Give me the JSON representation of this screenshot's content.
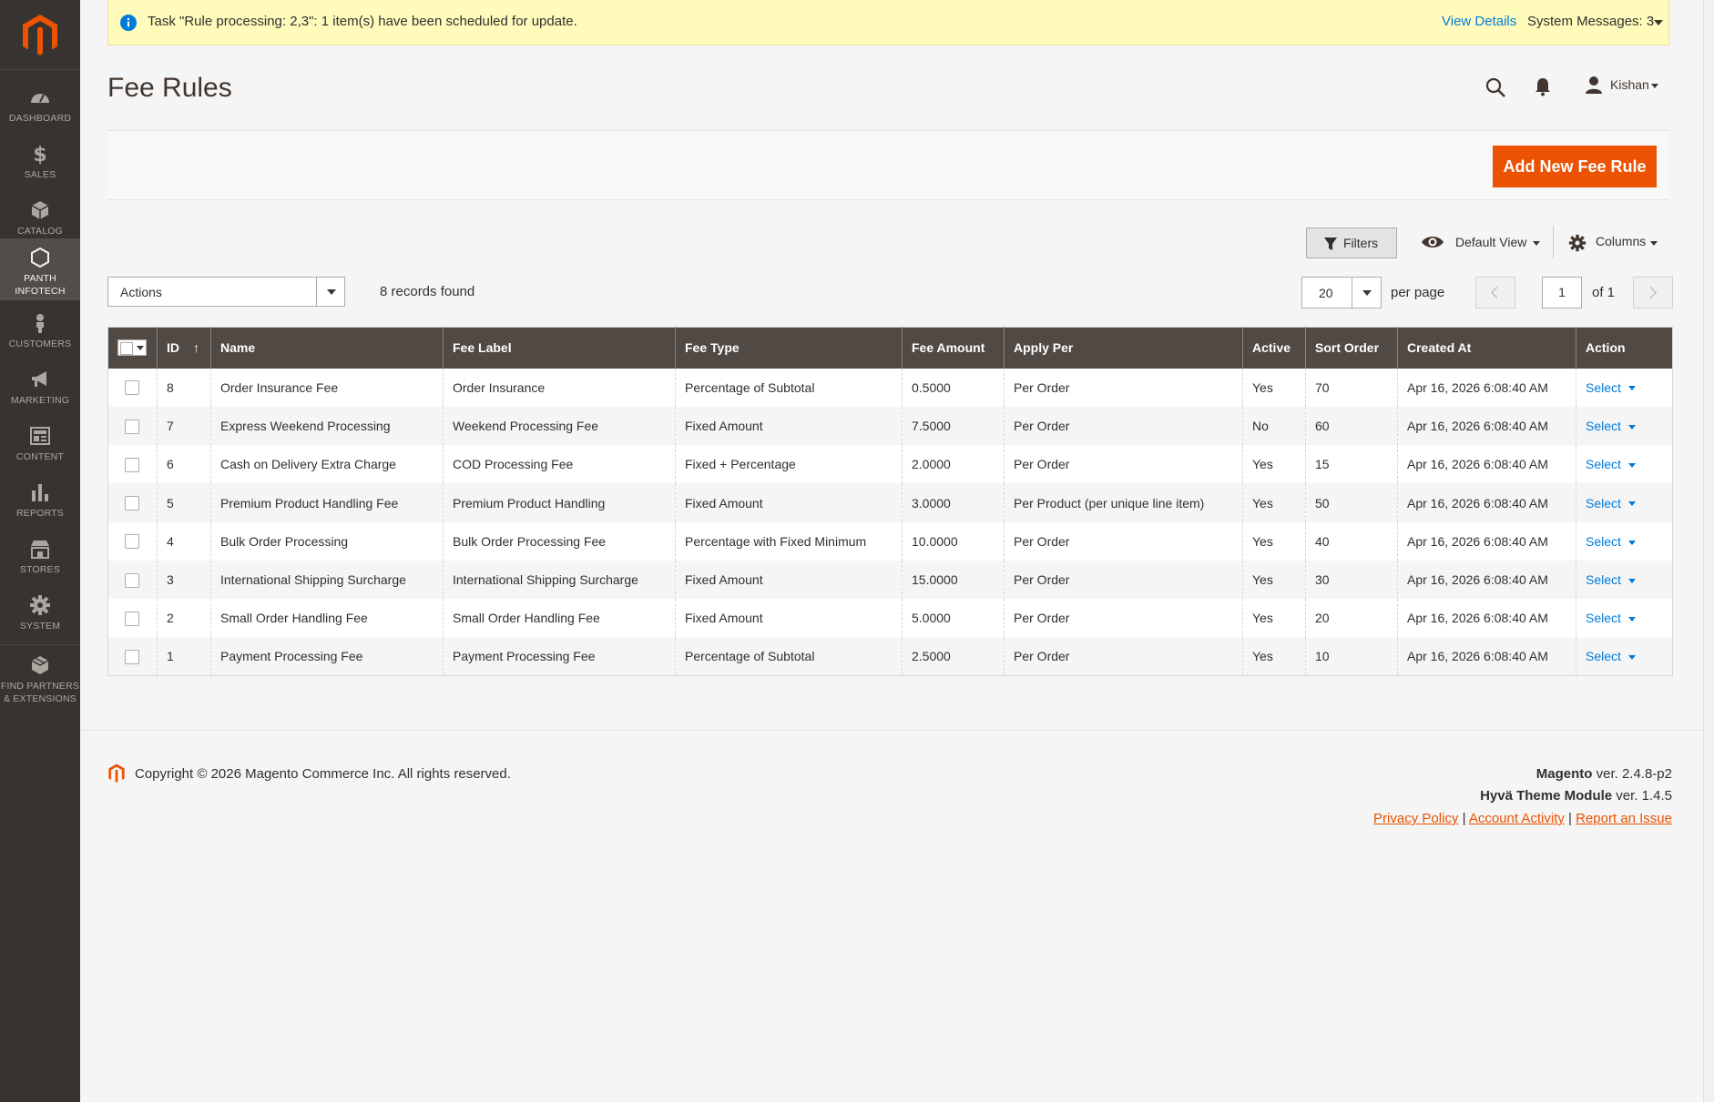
{
  "sidebar": {
    "items": [
      {
        "label": "DASHBOARD",
        "icon": "dashboard-icon"
      },
      {
        "label": "SALES",
        "icon": "dollar-icon"
      },
      {
        "label": "CATALOG",
        "icon": "cube-icon"
      },
      {
        "label1": "PANTH",
        "label2": "INFOTECH",
        "icon": "hexagon-icon",
        "active": true
      },
      {
        "label": "CUSTOMERS",
        "icon": "person-icon"
      },
      {
        "label": "MARKETING",
        "icon": "megaphone-icon"
      },
      {
        "label": "CONTENT",
        "icon": "content-icon"
      },
      {
        "label": "REPORTS",
        "icon": "bar-chart-icon"
      },
      {
        "label": "STORES",
        "icon": "store-icon"
      },
      {
        "label": "SYSTEM",
        "icon": "gear-icon"
      },
      {
        "label1": "FIND PARTNERS",
        "label2": "& EXTENSIONS",
        "icon": "box-icon"
      }
    ]
  },
  "message": {
    "text": "Task \"Rule processing: 2,3\": 1 item(s) have been scheduled for update.",
    "view_details": "View Details",
    "system_messages": "System Messages: 3"
  },
  "header": {
    "title": "Fee Rules",
    "user": "Kishan"
  },
  "toolbar": {
    "add_label": "Add New Fee Rule"
  },
  "grid_controls": {
    "filters": "Filters",
    "view": "Default View",
    "columns": "Columns",
    "actions": "Actions",
    "records": "8 records found",
    "per_page_value": "20",
    "per_page_label": "per page",
    "page": "1",
    "of": "of 1"
  },
  "table": {
    "headers": [
      "ID",
      "Name",
      "Fee Label",
      "Fee Type",
      "Fee Amount",
      "Apply Per",
      "Active",
      "Sort Order",
      "Created At",
      "Action"
    ],
    "rows": [
      [
        "8",
        "Order Insurance Fee",
        "Order Insurance",
        "Percentage of Subtotal",
        "0.5000",
        "Per Order",
        "Yes",
        "70",
        "Apr 16, 2026 6:08:40 AM",
        "Select"
      ],
      [
        "7",
        "Express Weekend Processing",
        "Weekend Processing Fee",
        "Fixed Amount",
        "7.5000",
        "Per Order",
        "No",
        "60",
        "Apr 16, 2026 6:08:40 AM",
        "Select"
      ],
      [
        "6",
        "Cash on Delivery Extra Charge",
        "COD Processing Fee",
        "Fixed + Percentage",
        "2.0000",
        "Per Order",
        "Yes",
        "15",
        "Apr 16, 2026 6:08:40 AM",
        "Select"
      ],
      [
        "5",
        "Premium Product Handling Fee",
        "Premium Product Handling",
        "Fixed Amount",
        "3.0000",
        "Per Product (per unique line item)",
        "Yes",
        "50",
        "Apr 16, 2026 6:08:40 AM",
        "Select"
      ],
      [
        "4",
        "Bulk Order Processing",
        "Bulk Order Processing Fee",
        "Percentage with Fixed Minimum",
        "10.0000",
        "Per Order",
        "Yes",
        "40",
        "Apr 16, 2026 6:08:40 AM",
        "Select"
      ],
      [
        "3",
        "International Shipping Surcharge",
        "International Shipping Surcharge",
        "Fixed Amount",
        "15.0000",
        "Per Order",
        "Yes",
        "30",
        "Apr 16, 2026 6:08:40 AM",
        "Select"
      ],
      [
        "2",
        "Small Order Handling Fee",
        "Small Order Handling Fee",
        "Fixed Amount",
        "5.0000",
        "Per Order",
        "Yes",
        "20",
        "Apr 16, 2026 6:08:40 AM",
        "Select"
      ],
      [
        "1",
        "Payment Processing Fee",
        "Payment Processing Fee",
        "Percentage of Subtotal",
        "2.5000",
        "Per Order",
        "Yes",
        "10",
        "Apr 16, 2026 6:08:40 AM",
        "Select"
      ]
    ]
  },
  "footer": {
    "copyright": "Copyright © 2026 Magento Commerce Inc. All rights reserved.",
    "magento_name": "Magento",
    "magento_ver": " ver. 2.4.8-p2",
    "hyva_name": "Hyvä Theme Module",
    "hyva_ver": " ver. 1.4.5",
    "privacy": "Privacy Policy",
    "account_activity": " Account Activity",
    "report_issue": "Report an Issue",
    "sep": " | "
  },
  "colors": {
    "accent": "#eb5202",
    "sidebar": "#373330",
    "table_header": "#514943",
    "link": "#007bdb",
    "message_bg": "#fffbbb"
  }
}
